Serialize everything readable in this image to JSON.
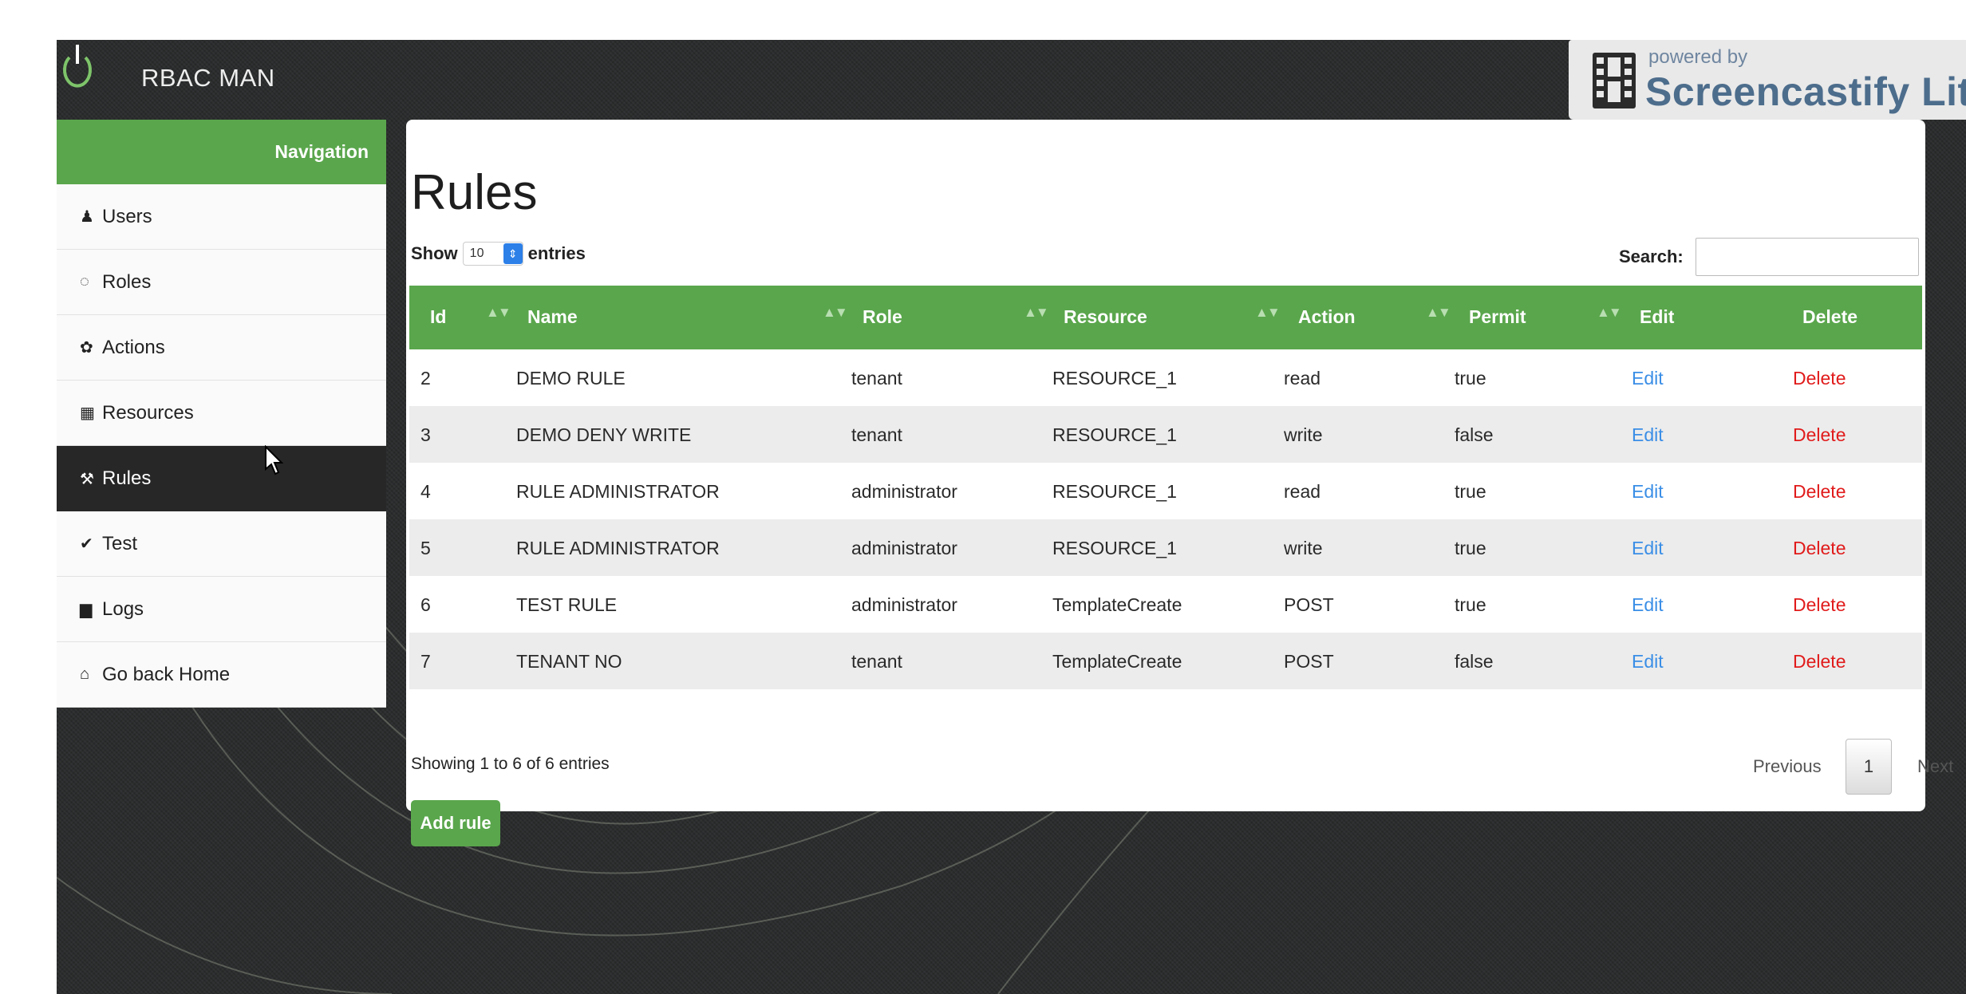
{
  "app": {
    "brand": "RBAC MAN"
  },
  "watermark": {
    "small": "powered by",
    "big": "Screencastify Lite"
  },
  "sidebar": {
    "header": "Navigation",
    "items": [
      {
        "label": "Users",
        "icon": "user-icon",
        "glyph": "♟",
        "active": false
      },
      {
        "label": "Roles",
        "icon": "spinner-icon",
        "glyph": "◌",
        "active": false
      },
      {
        "label": "Actions",
        "icon": "gear-icon",
        "glyph": "✿",
        "active": false
      },
      {
        "label": "Resources",
        "icon": "table-icon",
        "glyph": "▦",
        "active": false
      },
      {
        "label": "Rules",
        "icon": "wrench-icon",
        "glyph": "⚒",
        "active": true
      },
      {
        "label": "Test",
        "icon": "check-icon",
        "glyph": "✔",
        "active": false
      },
      {
        "label": "Logs",
        "icon": "file-icon",
        "glyph": "▆",
        "active": false
      },
      {
        "label": "Go back Home",
        "icon": "home-icon",
        "glyph": "⌂",
        "active": false
      }
    ]
  },
  "main": {
    "title": "Rules",
    "show_label": "Show",
    "entries_label": "entries",
    "page_size": "10",
    "search_label": "Search:",
    "search_value": "",
    "columns": [
      "Id",
      "Name",
      "Role",
      "Resource",
      "Action",
      "Permit",
      "Edit",
      "Delete"
    ],
    "rows": [
      {
        "id": "2",
        "name": "DEMO RULE",
        "role": "tenant",
        "resource": "RESOURCE_1",
        "action": "read",
        "permit": "true",
        "edit": "Edit",
        "delete": "Delete"
      },
      {
        "id": "3",
        "name": "DEMO DENY WRITE",
        "role": "tenant",
        "resource": "RESOURCE_1",
        "action": "write",
        "permit": "false",
        "edit": "Edit",
        "delete": "Delete"
      },
      {
        "id": "4",
        "name": "RULE ADMINISTRATOR",
        "role": "administrator",
        "resource": "RESOURCE_1",
        "action": "read",
        "permit": "true",
        "edit": "Edit",
        "delete": "Delete"
      },
      {
        "id": "5",
        "name": "RULE ADMINISTRATOR",
        "role": "administrator",
        "resource": "RESOURCE_1",
        "action": "write",
        "permit": "true",
        "edit": "Edit",
        "delete": "Delete"
      },
      {
        "id": "6",
        "name": "TEST RULE",
        "role": "administrator",
        "resource": "TemplateCreate",
        "action": "POST",
        "permit": "true",
        "edit": "Edit",
        "delete": "Delete"
      },
      {
        "id": "7",
        "name": "TENANT NO",
        "role": "tenant",
        "resource": "TemplateCreate",
        "action": "POST",
        "permit": "false",
        "edit": "Edit",
        "delete": "Delete"
      }
    ],
    "info": "Showing 1 to 6 of 6 entries",
    "pagination": {
      "previous": "Previous",
      "page": "1",
      "next": "Next"
    },
    "add_button": "Add rule"
  },
  "colors": {
    "accent": "#5aa64c",
    "edit_link": "#3a8ee6",
    "delete_link": "#e11b1b",
    "active_nav": "#272727"
  }
}
